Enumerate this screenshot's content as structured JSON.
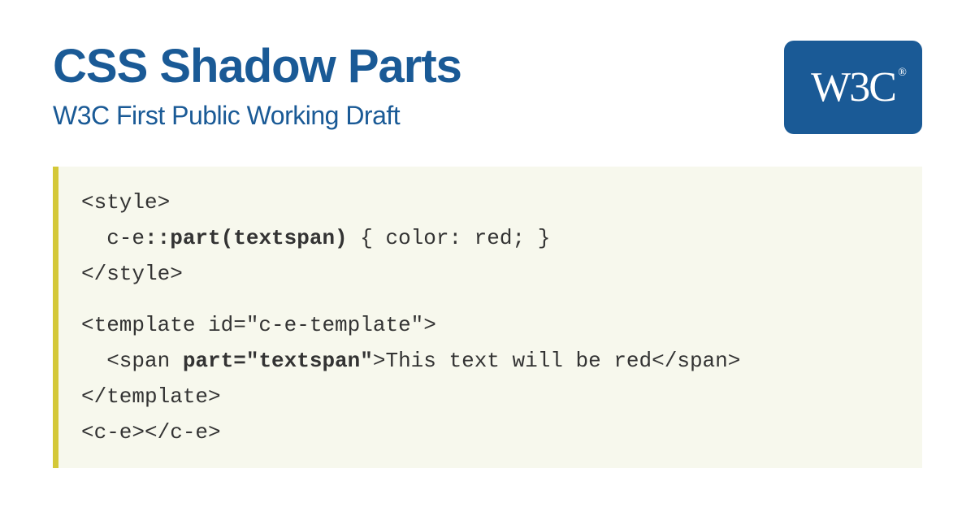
{
  "header": {
    "title": "CSS Shadow Parts",
    "subtitle": "W3C First Public Working Draft"
  },
  "logo": {
    "text": "W3C"
  },
  "code": {
    "block1": {
      "line1_a": "<style>",
      "line2_a": "  c-e",
      "line2_bold": "::part(textspan)",
      "line2_b": " { color: red; }",
      "line3_a": "</style>"
    },
    "block2": {
      "line1_a": "<template id=\"c-e-template\">",
      "line2_a": "  <span ",
      "line2_bold": "part=\"textspan\"",
      "line2_b": ">This text will be red</span>",
      "line3_a": "</template>",
      "line4_a": "<c-e></c-e>"
    }
  }
}
